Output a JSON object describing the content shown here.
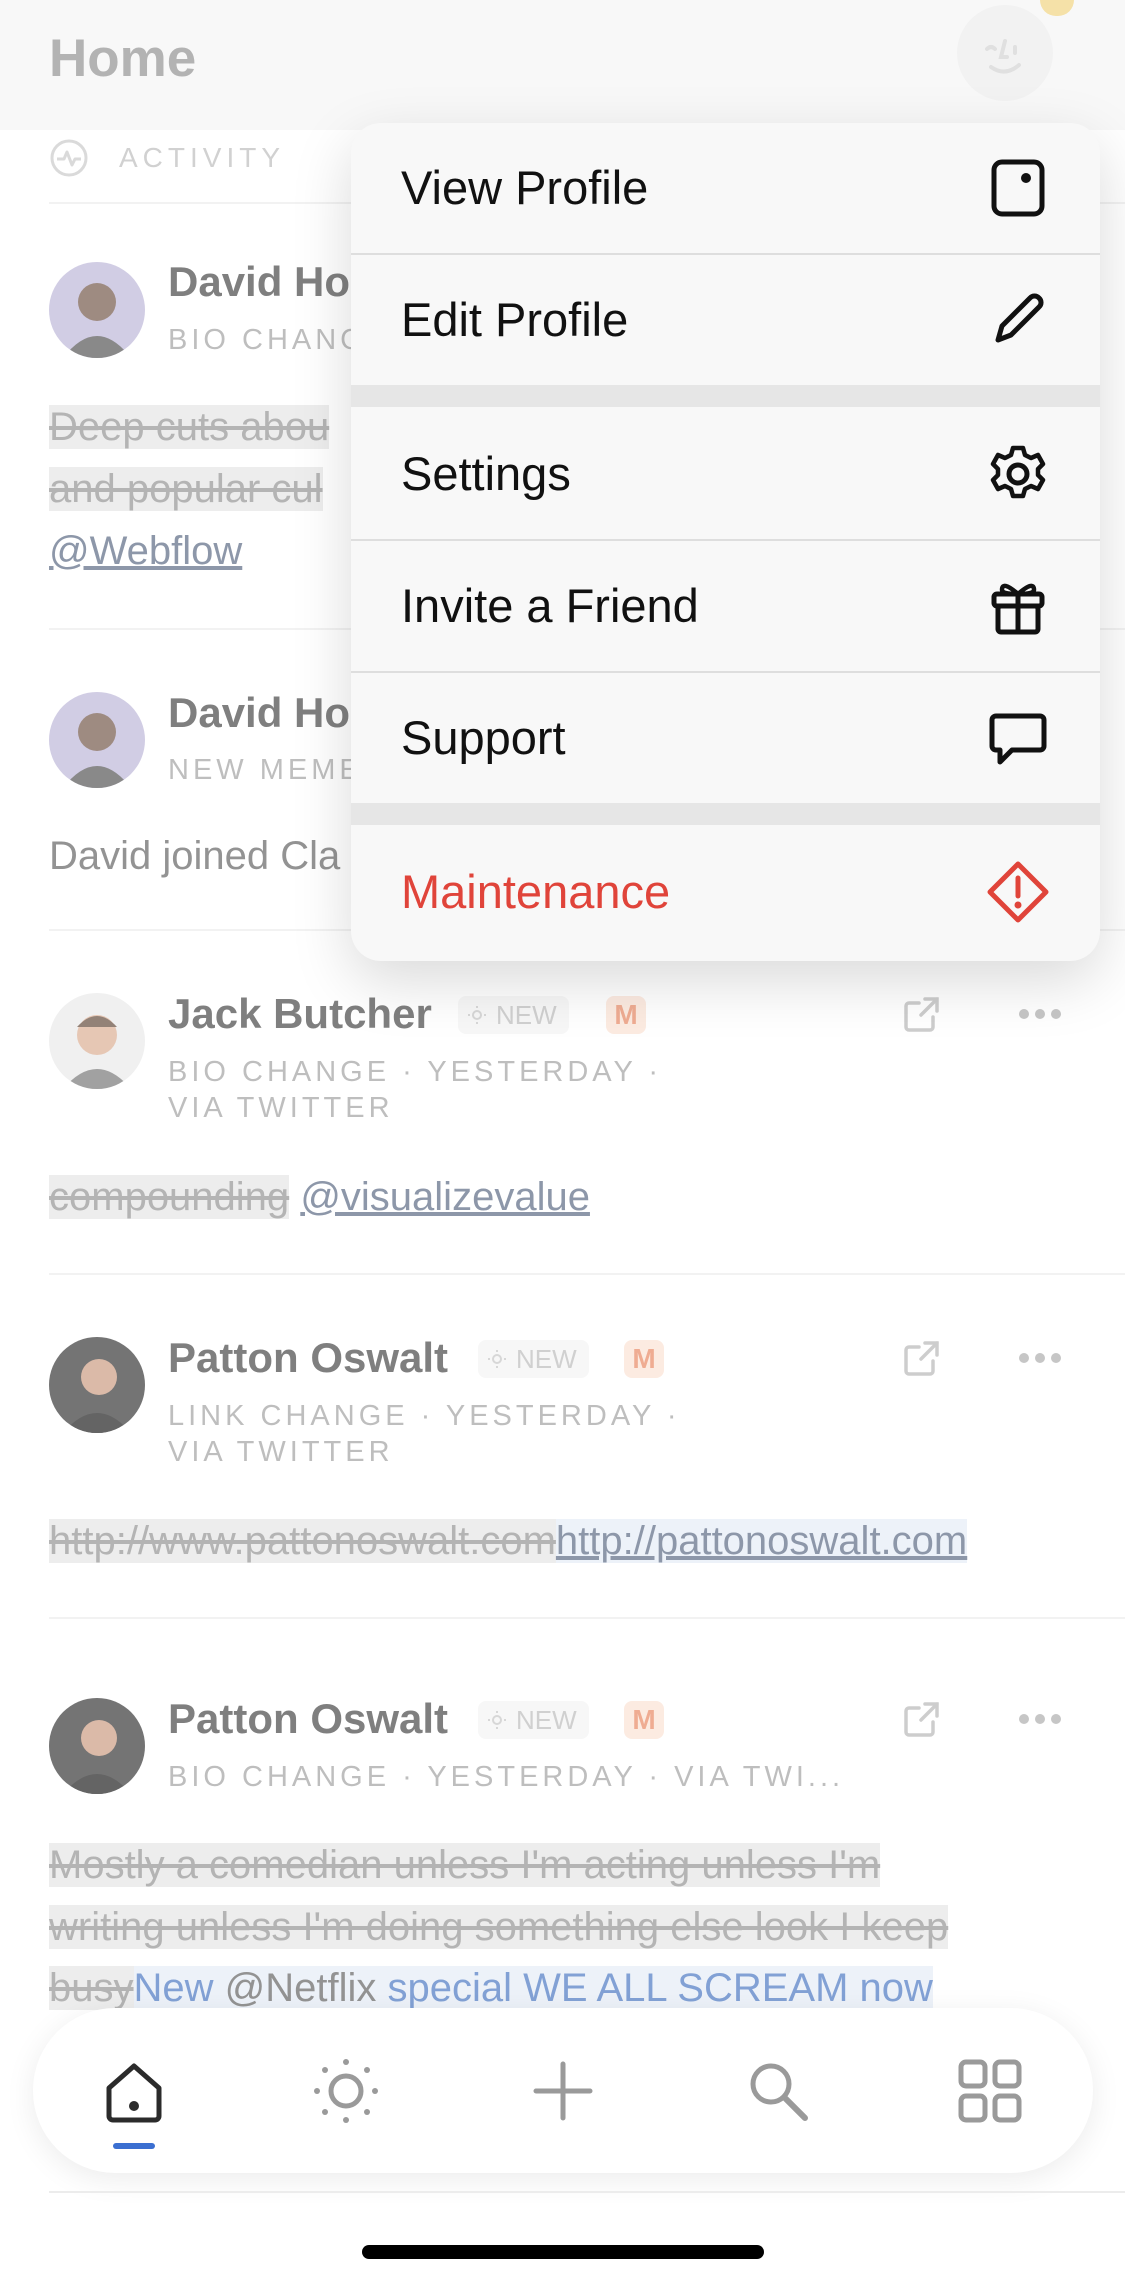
{
  "header": {
    "title": "Home"
  },
  "activity": {
    "label": "ACTIVITY"
  },
  "feed": {
    "items": [
      {
        "name": "David Ho",
        "meta": "BIO CHANC",
        "text_struck_1": "Deep cuts abou",
        "text_struck_2": "and popular cul",
        "link": "@Webflow"
      },
      {
        "name": "David Ho",
        "meta": "NEW MEME",
        "text": "David joined Cla"
      },
      {
        "name": "Jack Butcher",
        "badge_new": "NEW",
        "badge_m": "M",
        "meta_1": "BIO CHANGE · YESTERDAY ·",
        "meta_2": "VIA TWITTER",
        "text_struck": "compounding",
        "link": "@visualizevalue"
      },
      {
        "name": "Patton Oswalt",
        "badge_new": "NEW",
        "badge_m": "M",
        "meta_1": "LINK CHANGE · YESTERDAY ·",
        "meta_2": "VIA TWITTER",
        "text_struck": "http://www.pattonoswalt.com",
        "link": "http://pattonoswalt.com"
      },
      {
        "name": "Patton Oswalt",
        "badge_new": "NEW",
        "badge_m": "M",
        "meta_1": "BIO CHANGE · YESTERDAY · VIA TWI...",
        "line_1": "Mostly a comedian unless I'm acting unless I'm",
        "line_2": "writing unless I'm doing something else look I keep",
        "line_3_struck": "busy",
        "line_3_new_a": "New",
        "line_3_plain": " @Netflix ",
        "line_3_new_b": "special WE ALL SCREAM now"
      }
    ]
  },
  "menu": {
    "items": [
      {
        "label": "View Profile",
        "icon": "profile-card-icon"
      },
      {
        "label": "Edit Profile",
        "icon": "pencil-icon"
      },
      {
        "label": "Settings",
        "icon": "gear-icon"
      },
      {
        "label": "Invite a Friend",
        "icon": "gift-icon"
      },
      {
        "label": "Support",
        "icon": "chat-bubble-icon"
      },
      {
        "label": "Maintenance",
        "icon": "warning-diamond-icon"
      }
    ],
    "danger_color": "#e0443a"
  },
  "tabbar": {
    "tabs": [
      "home-icon",
      "sun-icon",
      "plus-icon",
      "search-icon",
      "grid-icon"
    ],
    "accent": "#3b6fd1"
  }
}
